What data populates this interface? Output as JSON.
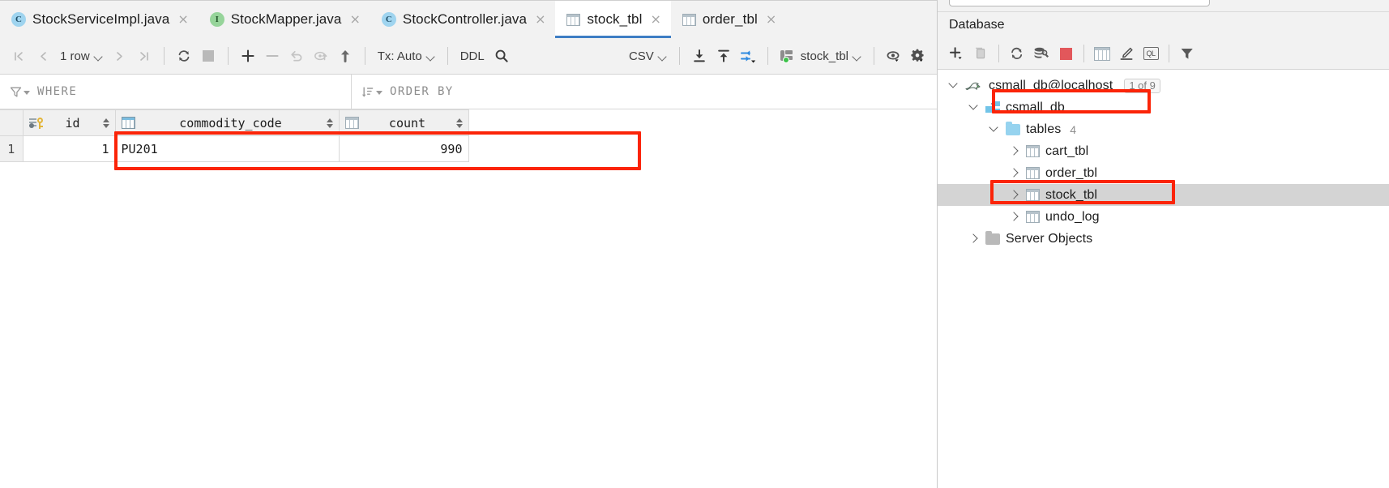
{
  "window": {
    "tabs": [
      {
        "label": "StockServiceImpl.java",
        "icon": "java-class-icon",
        "badge": "C",
        "badge_kind": "class",
        "active": false,
        "close": "×"
      },
      {
        "label": "StockMapper.java",
        "icon": "java-interface-icon",
        "badge": "I",
        "badge_kind": "interface",
        "active": false,
        "close": "×"
      },
      {
        "label": "StockController.java",
        "icon": "java-class-icon",
        "badge": "C",
        "badge_kind": "class",
        "active": false,
        "close": "×"
      },
      {
        "label": "stock_tbl",
        "icon": "db-table-icon",
        "badge": "",
        "badge_kind": "table",
        "active": true,
        "close": "×"
      },
      {
        "label": "order_tbl",
        "icon": "db-table-icon",
        "badge": "",
        "badge_kind": "table",
        "active": false,
        "close": "×"
      }
    ]
  },
  "toolbar": {
    "first_page": "❘❮",
    "prev_page": "❮",
    "row_count_label": "1 row",
    "next_page": "❯",
    "last_page": "❯❘",
    "reload": "reload-icon",
    "stop": "stop-icon",
    "add_row": "+",
    "delete_row": "−",
    "revert": "revert-icon",
    "revert_selected": "revert-selected-icon",
    "submit": "⬆",
    "tx_label": "Tx: Auto",
    "ddl_label": "DDL",
    "search": "search-icon",
    "csv_label": "CSV",
    "export_to_file": "download-icon",
    "import_from_file": "upload-icon",
    "compare": "compare-icon",
    "table_chooser_label": "stock_tbl",
    "view_options": "eye-icon",
    "settings": "gear-icon"
  },
  "filters": {
    "where_label": "WHERE",
    "where_value": "",
    "order_by_label": "ORDER BY",
    "order_by_value": ""
  },
  "grid": {
    "columns": [
      {
        "name": "id",
        "icon": "primary-key-icon",
        "align": "right"
      },
      {
        "name": "commodity_code",
        "icon": "column-icon-blue",
        "align": "left"
      },
      {
        "name": "count",
        "icon": "column-icon",
        "align": "right"
      }
    ],
    "rows": [
      {
        "num": "1",
        "id": "1",
        "commodity_code": "PU201",
        "count": "990"
      }
    ]
  },
  "annotations": {
    "accent_color": "#fb2408",
    "boxes": [
      {
        "name": "highlight-data-row",
        "target": "grid-row-1"
      },
      {
        "name": "highlight-csmall-db",
        "target": "tree-csmall-db"
      },
      {
        "name": "highlight-stock-tbl",
        "target": "tree-stock-tbl"
      }
    ]
  },
  "database_panel": {
    "title": "Database",
    "toolbar": {
      "new": "plus-icon",
      "duplicate": "copy-icon",
      "refresh": "refresh-icon",
      "run_configuration": "db-tools-icon",
      "stop": "stop-square-icon",
      "jump_to_table": "table-icon",
      "modify": "pencil-icon",
      "query_console": "QL",
      "filter": "filter-icon"
    },
    "tree": [
      {
        "label": "csmall_db@localhost",
        "icon": "mysql-icon",
        "indent": 0,
        "expanded": true,
        "badge": "1 of 9",
        "count": "",
        "selected": false,
        "highlighted": false
      },
      {
        "label": "csmall_db",
        "icon": "schema-icon",
        "indent": 1,
        "expanded": true,
        "badge": "",
        "count": "",
        "selected": false,
        "highlighted": true
      },
      {
        "label": "tables",
        "icon": "folder-icon",
        "indent": 2,
        "expanded": true,
        "badge": "",
        "count": "4",
        "selected": false,
        "highlighted": false
      },
      {
        "label": "cart_tbl",
        "icon": "db-table-icon",
        "indent": 3,
        "expanded": false,
        "badge": "",
        "count": "",
        "selected": false,
        "highlighted": false
      },
      {
        "label": "order_tbl",
        "icon": "db-table-icon",
        "indent": 3,
        "expanded": false,
        "badge": "",
        "count": "",
        "selected": false,
        "highlighted": false
      },
      {
        "label": "stock_tbl",
        "icon": "db-table-icon",
        "indent": 3,
        "expanded": false,
        "badge": "",
        "count": "",
        "selected": true,
        "highlighted": true
      },
      {
        "label": "undo_log",
        "icon": "db-table-icon",
        "indent": 3,
        "expanded": false,
        "badge": "",
        "count": "",
        "selected": false,
        "highlighted": false
      },
      {
        "label": "Server Objects",
        "icon": "folder-grey-icon",
        "indent": 1,
        "expanded": false,
        "badge": "",
        "count": "",
        "selected": false,
        "highlighted": false
      }
    ]
  }
}
